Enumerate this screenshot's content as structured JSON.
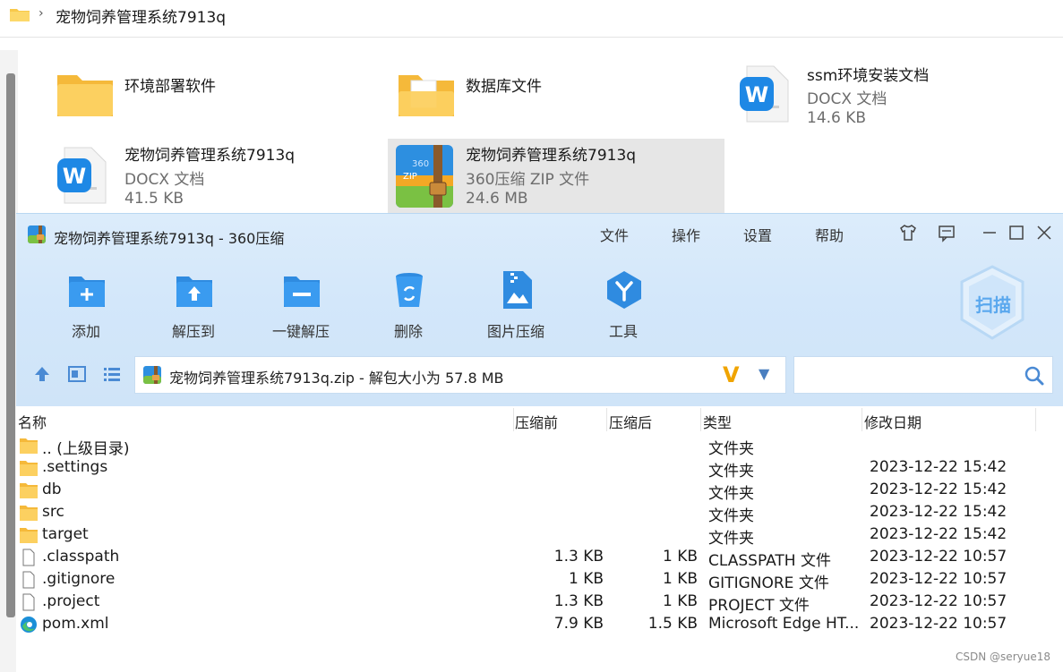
{
  "explorer": {
    "address_path": "宠物饲养管理系统7913q",
    "items": [
      {
        "name": "环境部署软件",
        "type_label": "",
        "size": "",
        "icon": "folder-icon"
      },
      {
        "name": "数据库文件",
        "type_label": "",
        "size": "",
        "icon": "folder-docs-icon"
      },
      {
        "name": "ssm环境安装文档",
        "type_label": "DOCX 文档",
        "size": "14.6 KB",
        "icon": "wps-doc-icon"
      },
      {
        "name": "宠物饲养管理系统7913q",
        "type_label": "DOCX 文档",
        "size": "41.5 KB",
        "icon": "wps-doc-icon"
      },
      {
        "name": "宠物饲养管理系统7913q",
        "type_label": "360压缩 ZIP 文件",
        "size": "24.6 MB",
        "icon": "zip-archive-icon"
      }
    ]
  },
  "zip_window": {
    "title": "宠物饲养管理系统7913q - 360压缩",
    "menu": [
      "文件",
      "操作",
      "设置",
      "帮助"
    ],
    "toolbar": [
      {
        "label": "添加",
        "icon": "add-folder-icon"
      },
      {
        "label": "解压到",
        "icon": "extract-to-icon"
      },
      {
        "label": "一键解压",
        "icon": "one-click-extract-icon"
      },
      {
        "label": "删除",
        "icon": "recycle-bin-icon"
      },
      {
        "label": "图片压缩",
        "icon": "image-compress-icon"
      },
      {
        "label": "工具",
        "icon": "tools-icon"
      }
    ],
    "scan_label": "扫描",
    "path_text": "宠物饲养管理系统7913q.zip - 解包大小为 57.8 MB",
    "path_v_glyph": "V",
    "columns": {
      "name": "名称",
      "before": "压缩前",
      "after": "压缩后",
      "type": "类型",
      "modified": "修改日期"
    },
    "rows": [
      {
        "name": ".. (上级目录)",
        "before": "",
        "after": "",
        "type": "文件夹",
        "modified": "",
        "icon": "folder-icon"
      },
      {
        "name": ".settings",
        "before": "",
        "after": "",
        "type": "文件夹",
        "modified": "2023-12-22 15:42",
        "icon": "folder-icon"
      },
      {
        "name": "db",
        "before": "",
        "after": "",
        "type": "文件夹",
        "modified": "2023-12-22 15:42",
        "icon": "folder-icon"
      },
      {
        "name": "src",
        "before": "",
        "after": "",
        "type": "文件夹",
        "modified": "2023-12-22 15:42",
        "icon": "folder-icon"
      },
      {
        "name": "target",
        "before": "",
        "after": "",
        "type": "文件夹",
        "modified": "2023-12-22 15:42",
        "icon": "folder-icon"
      },
      {
        "name": ".classpath",
        "before": "1.3 KB",
        "after": "1 KB",
        "type": "CLASSPATH 文件",
        "modified": "2023-12-22 10:57",
        "icon": "file-icon"
      },
      {
        "name": ".gitignore",
        "before": "1 KB",
        "after": "1 KB",
        "type": "GITIGNORE 文件",
        "modified": "2023-12-22 10:57",
        "icon": "file-icon"
      },
      {
        "name": ".project",
        "before": "1.3 KB",
        "after": "1 KB",
        "type": "PROJECT 文件",
        "modified": "2023-12-22 10:57",
        "icon": "file-icon"
      },
      {
        "name": "pom.xml",
        "before": "7.9 KB",
        "after": "1.5 KB",
        "type": "Microsoft Edge HT...",
        "modified": "2023-12-22 10:57",
        "icon": "edge-icon"
      }
    ]
  },
  "watermark": "CSDN @seryue18",
  "colors": {
    "accent": "#2f8be0",
    "folder": "#f8c94a",
    "window_bg": "#d6e9fa",
    "selected_tile": "#e6e6e6"
  }
}
